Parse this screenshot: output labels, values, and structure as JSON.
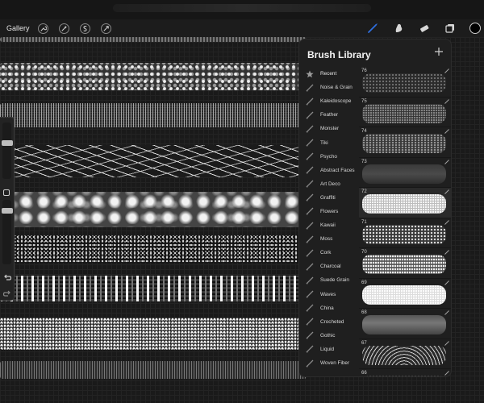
{
  "toolbar": {
    "gallery_label": "Gallery",
    "left_tools": [
      {
        "icon": "wrench-icon"
      },
      {
        "icon": "magic-wand-icon"
      },
      {
        "icon": "selection-icon"
      },
      {
        "icon": "transform-arrow-icon"
      }
    ],
    "right_tools": [
      {
        "icon": "brush-icon",
        "active": true
      },
      {
        "icon": "smudge-icon"
      },
      {
        "icon": "eraser-icon"
      },
      {
        "icon": "layers-icon"
      }
    ],
    "current_color": "#000000",
    "accent_color": "#2f6fe0"
  },
  "brush_library": {
    "title": "Brush Library",
    "add_icon": "plus-icon",
    "categories": [
      {
        "label": "Recent",
        "icon": "star-icon"
      },
      {
        "label": "Noise & Grain",
        "icon": "brush-set-icon"
      },
      {
        "label": "Kaleidoscope",
        "icon": "brush-set-icon"
      },
      {
        "label": "Feather",
        "icon": "brush-set-icon"
      },
      {
        "label": "Monster",
        "icon": "brush-set-icon"
      },
      {
        "label": "Tiki",
        "icon": "brush-set-icon"
      },
      {
        "label": "Psycho",
        "icon": "brush-set-icon"
      },
      {
        "label": "Abstract Faces",
        "icon": "brush-set-icon"
      },
      {
        "label": "Art Deco",
        "icon": "brush-set-icon"
      },
      {
        "label": "Graffiti",
        "icon": "brush-set-icon"
      },
      {
        "label": "Flowers",
        "icon": "brush-set-icon"
      },
      {
        "label": "Kawaii",
        "icon": "brush-set-icon"
      },
      {
        "label": "Moss",
        "icon": "brush-set-icon"
      },
      {
        "label": "Cork",
        "icon": "brush-set-icon"
      },
      {
        "label": "Charcoal",
        "icon": "brush-set-icon"
      },
      {
        "label": "Suede Grain",
        "icon": "brush-set-icon"
      },
      {
        "label": "Waves",
        "icon": "brush-set-icon"
      },
      {
        "label": "China",
        "icon": "brush-set-icon"
      },
      {
        "label": "Crocheted",
        "icon": "brush-set-icon"
      },
      {
        "label": "Gothic",
        "icon": "brush-set-icon"
      },
      {
        "label": "Liquid",
        "icon": "brush-set-icon"
      },
      {
        "label": "Woven Fiber",
        "icon": "brush-set-icon"
      }
    ],
    "brushes": [
      {
        "number": "76"
      },
      {
        "number": "75"
      },
      {
        "number": "74"
      },
      {
        "number": "73"
      },
      {
        "number": "72"
      },
      {
        "number": "71"
      },
      {
        "number": "70"
      },
      {
        "number": "69"
      },
      {
        "number": "68"
      },
      {
        "number": "67"
      },
      {
        "number": "66"
      }
    ]
  },
  "sidebar": {
    "undo_icon": "undo-icon",
    "redo_icon": "redo-icon",
    "modify_icon": "square-modify-icon"
  }
}
